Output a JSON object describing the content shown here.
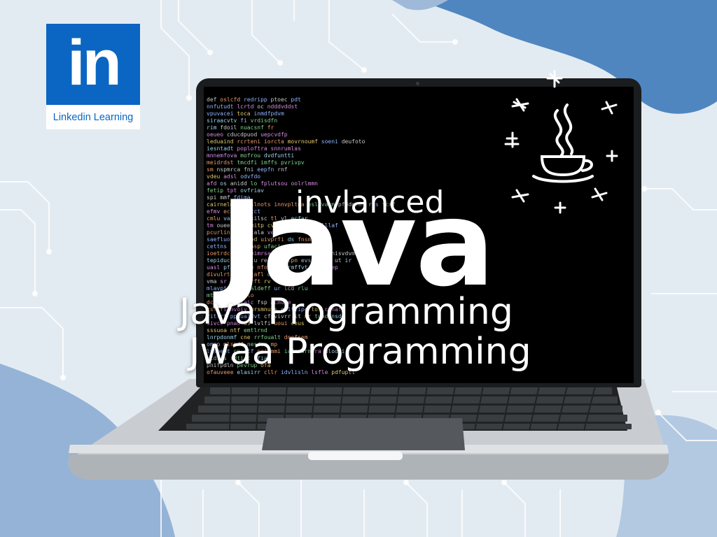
{
  "colors": {
    "background": "#e3ebf2",
    "accent_blue": "#4f86c0",
    "linkedin_blue": "#0a66c2",
    "screen": "#000000",
    "laptop_body": "#c9cdd1",
    "headline_text": "#ffffff"
  },
  "logo": {
    "mark": "in",
    "caption": "Linkedin Learning",
    "icon": "linkedin-icon"
  },
  "headline": {
    "line1": "invlanced",
    "line2": "Java",
    "line3": "Java Programming",
    "line4": "Jwaa Programming"
  },
  "decor": {
    "coffee_icon": "java-coffee-cup-icon",
    "sparkle_icons": [
      "sparkle-icon",
      "sparkle-icon",
      "sparkle-icon",
      "sparkle-icon",
      "sparkle-icon",
      "sparkle-icon",
      "sparkle-icon",
      "sparkle-icon"
    ]
  }
}
